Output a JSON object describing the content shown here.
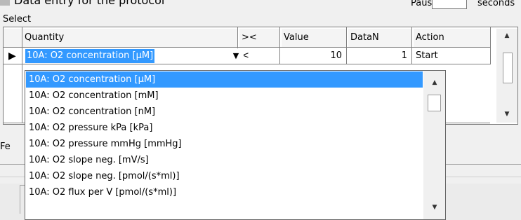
{
  "header": {
    "partial_title": "Data entry for the protocol",
    "pause_label": "Pause",
    "pause_value": "",
    "pause_unit": "seconds"
  },
  "select_label": "Select",
  "grid": {
    "columns": [
      "Quantity",
      "><",
      "Value",
      "DataN",
      "Action"
    ],
    "row": {
      "indicator": "▶",
      "quantity": "10A: O2 concentration [µM]",
      "comparator": "<",
      "value": "10",
      "datan": "1",
      "action": "Start"
    }
  },
  "lower": {
    "fe_label": "Fe"
  },
  "dropdown": {
    "options": [
      "10A: O2 concentration [µM]",
      "10A: O2 concentration [mM]",
      "10A: O2 concentration [nM]",
      "10A: O2 pressure kPa [kPa]",
      "10A: O2 pressure mmHg [mmHg]",
      "10A: O2 slope neg. [mV/s]",
      "10A: O2 slope neg. [pmol/(s*ml)]",
      "10A: O2 flux per V [pmol/(s*ml)]"
    ],
    "selected_index": 0
  },
  "icons": {
    "row_indicator": "triangle-right-icon",
    "combo_button": "chevron-down-icon",
    "scroll_up": "arrow-up-icon",
    "scroll_down": "arrow-down-icon"
  }
}
